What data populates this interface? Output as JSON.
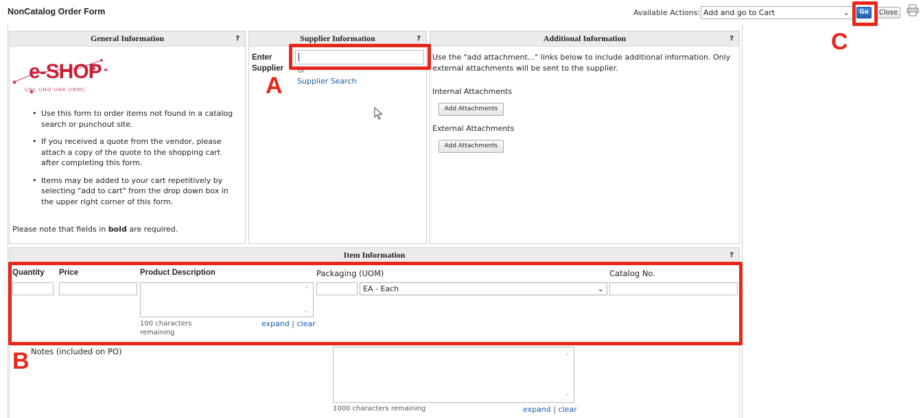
{
  "header": {
    "title": "NonCatalog Order Form",
    "actions_label": "Available Actions:",
    "actions_selected": "Add and go to Cart",
    "go_label": "Go",
    "close_label": "Close"
  },
  "general": {
    "title": "General Information",
    "help": "?",
    "logo_text": "e-SHOP",
    "logo_tagline": "UNL·UNO·UNK·UNMC",
    "bullets": [
      "Use this form to order items not found in a catalog search or punchout site.",
      "If you received a quote from the vendor, please attach a copy of the quote to the shopping cart after completing this form.",
      "Items may be added to your cart repetitively by selecting \"add to cart\" from the drop down box in the upper right corner of this form."
    ],
    "note_pre": "Please note that fields in ",
    "note_bold": "bold",
    "note_post": " are required."
  },
  "supplier": {
    "title": "Supplier Information",
    "help": "?",
    "label_line1": "Enter",
    "label_line2": "Supplier",
    "or_text": "or",
    "search_link": "Supplier Search"
  },
  "additional": {
    "title": "Additional Information",
    "help": "?",
    "intro": "Use the \"add attachment...\" links below to include additional information. Only external attachments will be sent to the supplier.",
    "internal_label": "Internal Attachments",
    "external_label": "External Attachments",
    "add_button": "Add Attachments"
  },
  "item": {
    "title": "Item Information",
    "help": "?",
    "quantity_label": "Quantity",
    "price_label": "Price",
    "description_label": "Product Description",
    "packaging_label": "Packaging (UOM)",
    "uom_selected": "EA - Each",
    "catalog_label": "Catalog No.",
    "desc_remaining_line1": "100 characters",
    "desc_remaining_line2": "remaining",
    "expand": "expand",
    "clear": "clear",
    "notes_label": "Notes (included on PO)",
    "notes_remaining": "1000 characters remaining"
  },
  "callouts": {
    "a": "A",
    "b": "B",
    "c": "C"
  },
  "colors": {
    "highlight": "#e8261b",
    "link": "#1a5aa6",
    "go_button": "#2a6cc6",
    "panel_header": "#ebebeb"
  }
}
